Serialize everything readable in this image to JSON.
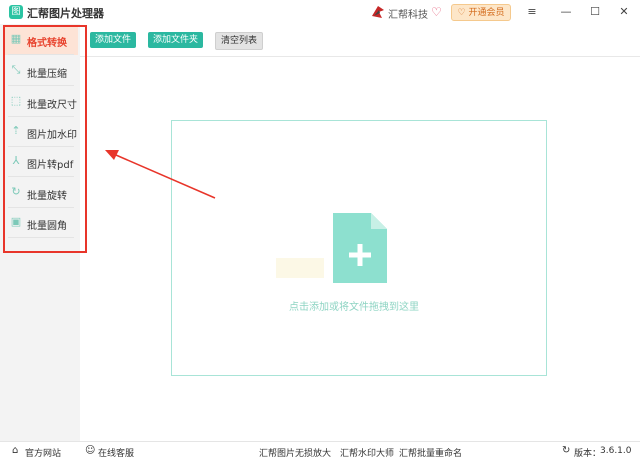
{
  "app": {
    "title": "汇帮图片处理器",
    "logo_glyph": "图"
  },
  "header": {
    "brand_name": "汇帮科技",
    "vip_label": "开通会员",
    "vip_icon": "heart-icon"
  },
  "window_controls": {
    "menu": "≡",
    "minimize": "—",
    "maximize": "☐",
    "close": "✕"
  },
  "toolbar": {
    "add_file": "添加文件",
    "add_folder": "添加文件夹",
    "clear_list": "清空列表"
  },
  "sidebar": {
    "items": [
      {
        "label": "格式转换",
        "icon": "convert-icon",
        "active": true
      },
      {
        "label": "批量压缩",
        "icon": "compress-icon"
      },
      {
        "label": "批量改尺寸",
        "icon": "resize-icon"
      },
      {
        "label": "图片加水印",
        "icon": "watermark-icon"
      },
      {
        "label": "图片转pdf",
        "icon": "pdf-icon"
      },
      {
        "label": "批量旋转",
        "icon": "rotate-icon"
      },
      {
        "label": "批量圆角",
        "icon": "round-corner-icon"
      }
    ]
  },
  "dropzone": {
    "hint": "点击添加或将文件拖拽到这里"
  },
  "statusbar": {
    "website": "官方网站",
    "support": "在线客服",
    "links": [
      "汇帮图片无损放大",
      "汇帮水印大师",
      "汇帮批量重命名"
    ],
    "version_label": "版本：",
    "version": "3.6.1.0"
  },
  "colors": {
    "accent": "#2bb8a0",
    "active_bg": "#fde3d6",
    "active_text": "#e8442f",
    "highlight": "#e8352a"
  }
}
